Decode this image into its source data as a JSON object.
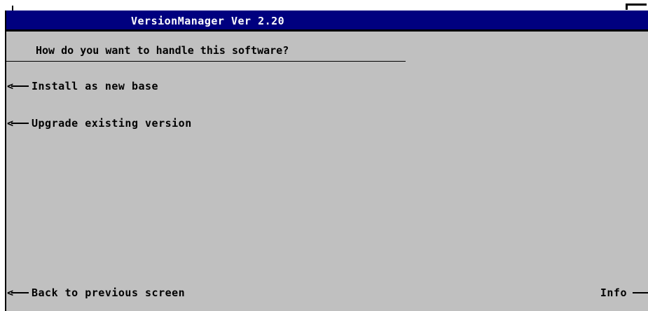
{
  "window": {
    "title": "VersionManager Ver 2.20"
  },
  "main": {
    "question": "How do you want to handle this software?",
    "options": [
      {
        "label": "Install as new base",
        "icon": "arrow-left-icon"
      },
      {
        "label": "Upgrade existing version",
        "icon": "arrow-left-icon"
      }
    ]
  },
  "footer": {
    "back_label": "Back to previous screen",
    "info_label": "Info"
  },
  "colors": {
    "title_bar": "#00007f",
    "background": "#c0c0c0",
    "title_text": "#ffffff"
  }
}
